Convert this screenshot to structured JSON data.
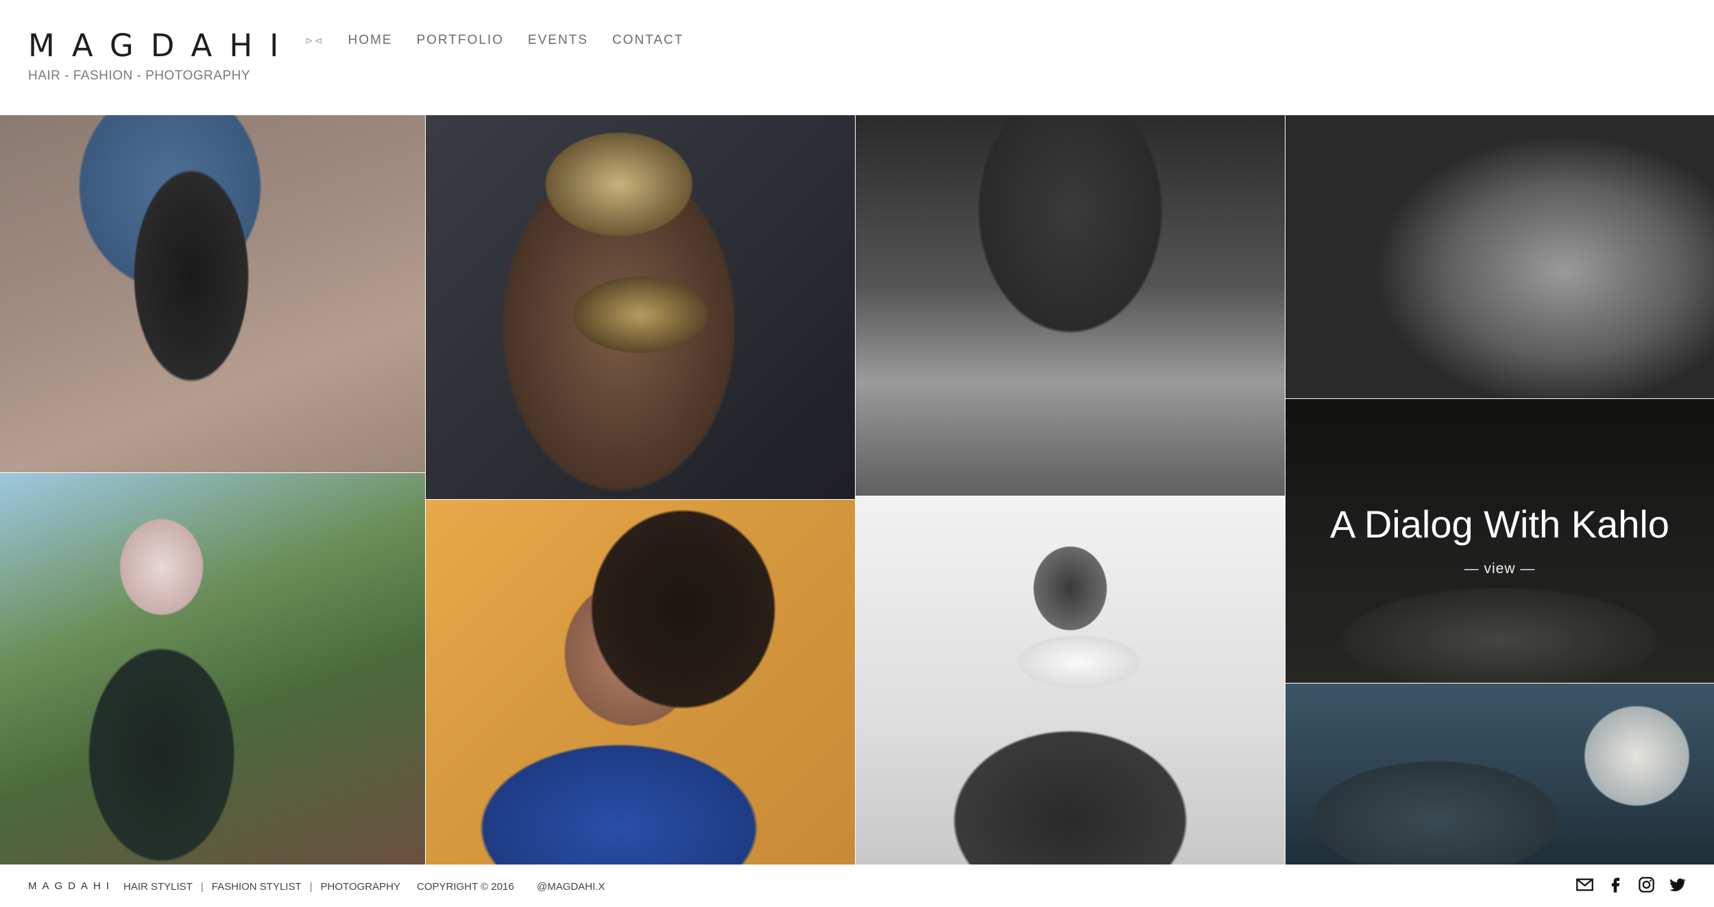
{
  "brand": {
    "logo": "MAGDAHI",
    "tagline": "HAIR - FASHION - PHOTOGRAPHY"
  },
  "nav": {
    "ornament": "⊳⊲",
    "items": [
      {
        "label": "HOME"
      },
      {
        "label": "PORTFOLIO"
      },
      {
        "label": "EVENTS"
      },
      {
        "label": "CONTACT"
      }
    ]
  },
  "gallery": {
    "feature": {
      "title": "A Dialog With Kahlo",
      "link": "— view —"
    }
  },
  "footer": {
    "logo": "MAGDAHI",
    "links": [
      "HAIR STYLIST",
      "FASHION STYLIST",
      "PHOTOGRAPHY"
    ],
    "separator": "|",
    "copyright": "COPYRIGHT © 2016",
    "handle": "@MAGDAHI.X",
    "social_icons": [
      "mail-icon",
      "facebook-icon",
      "instagram-icon",
      "twitter-icon"
    ]
  },
  "colors": {
    "text_dark": "#1e1e1e",
    "text_muted": "#7b7b7b",
    "background": "#ffffff"
  }
}
